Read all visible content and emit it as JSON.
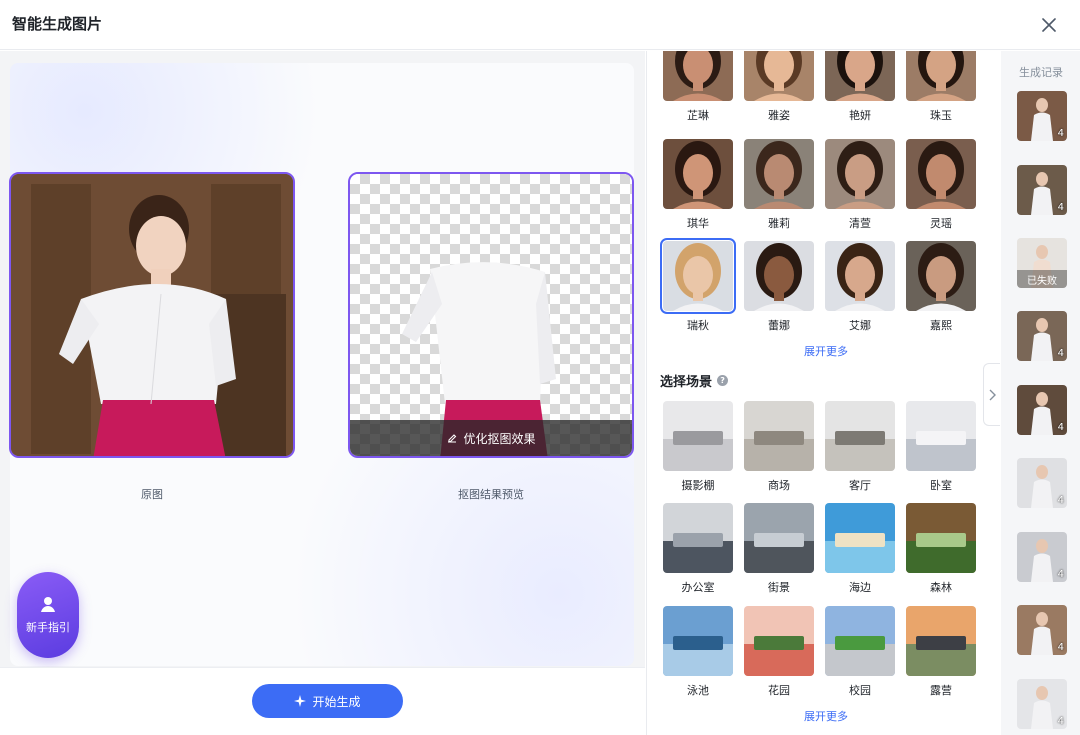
{
  "header": {
    "title": "智能生成图片",
    "close_icon": "close-icon"
  },
  "preview": {
    "original_caption": "原图",
    "cutout_caption": "抠图结果预览",
    "optimize_label": "优化抠图效果"
  },
  "guide": {
    "label": "新手指引"
  },
  "actions": {
    "start_label": "开始生成"
  },
  "models": {
    "items": [
      "芷琳",
      "雅姿",
      "艳妍",
      "珠玉",
      "琪华",
      "雅莉",
      "清萱",
      "灵瑶",
      "瑞秋",
      "蕾娜",
      "艾娜",
      "嘉熙"
    ],
    "selected": "瑞秋",
    "expand_label": "展开更多"
  },
  "scenes": {
    "title": "选择场景",
    "help_icon": "?",
    "items": [
      "摄影棚",
      "商场",
      "客厅",
      "卧室",
      "办公室",
      "街景",
      "海边",
      "森林",
      "泳池",
      "花园",
      "校园",
      "露营"
    ],
    "expand_label": "展开更多"
  },
  "history": {
    "title": "生成记录",
    "items": [
      {
        "count": "4"
      },
      {
        "count": "4"
      },
      {
        "status": "已失败"
      },
      {
        "count": "4"
      },
      {
        "count": "4"
      },
      {
        "count": "4"
      },
      {
        "count": "4"
      },
      {
        "count": "4"
      },
      {
        "count": "4"
      }
    ]
  },
  "colors": {
    "accent": "#3c6cf5",
    "frame": "#7d57f0",
    "guide": "#6b45e6"
  }
}
